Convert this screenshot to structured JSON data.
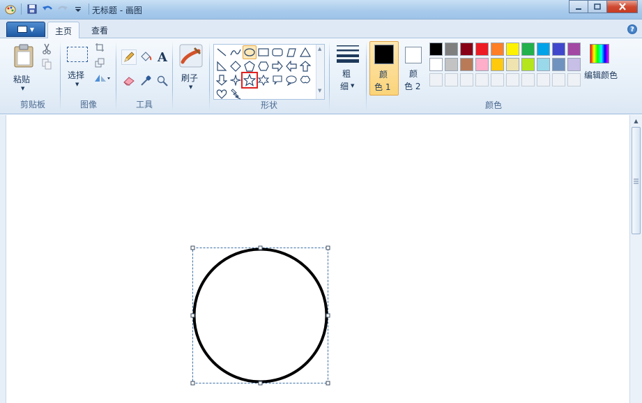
{
  "window": {
    "title": "无标题 - 画图"
  },
  "tabs": [
    {
      "label": "主页",
      "active": true
    },
    {
      "label": "查看",
      "active": false
    }
  ],
  "groups": {
    "clipboard": {
      "label": "剪贴板",
      "paste_label": "粘贴"
    },
    "image": {
      "label": "图像",
      "select_label": "选择"
    },
    "tools": {
      "label": "工具"
    },
    "brushes": {
      "label": "刷子"
    },
    "shapes": {
      "label": "形状",
      "highlighted_shape": "star-5-point"
    },
    "size": {
      "label_top": "粗",
      "label_bottom": "细"
    },
    "colors": {
      "label": "颜色",
      "color1_top": "颜",
      "color1_bottom": "色 1",
      "color2_top": "颜",
      "color2_bottom": "色 2",
      "edit_colors": "编辑颜色",
      "color1_value": "#000000",
      "color2_value": "#ffffff",
      "palette_row1": [
        "#000000",
        "#7f7f7f",
        "#880015",
        "#ed1c24",
        "#ff7f27",
        "#fff200",
        "#22b14c",
        "#00a2e8",
        "#3f48cc",
        "#a349a4"
      ],
      "palette_row2": [
        "#ffffff",
        "#c3c3c3",
        "#b97a57",
        "#ffaec9",
        "#ffc90e",
        "#efe4b0",
        "#b5e61d",
        "#99d9ea",
        "#7092be",
        "#c8bfe7"
      ],
      "palette_row3": [
        "#ffffff",
        "#ffffff",
        "#ffffff",
        "#ffffff",
        "#ffffff",
        "#ffffff",
        "#ffffff",
        "#ffffff",
        "#ffffff",
        "#ffffff"
      ]
    }
  }
}
